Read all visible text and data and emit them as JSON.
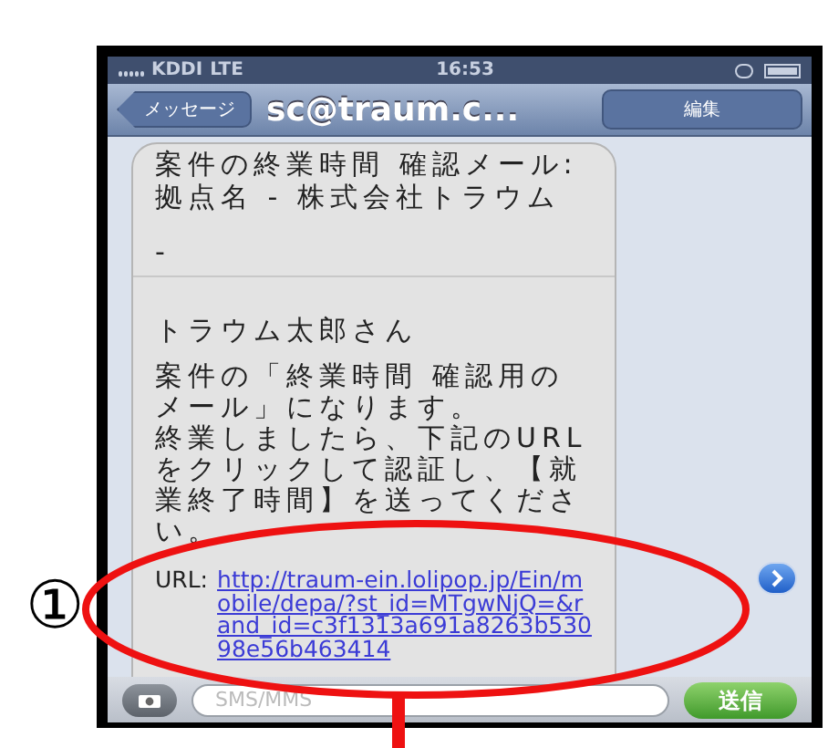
{
  "status_bar": {
    "carrier": "KDDI",
    "network": "LTE",
    "time": "16:53"
  },
  "nav_bar": {
    "back": "メッセージ",
    "title": "sc@traum.c...",
    "edit": "編集"
  },
  "message": {
    "subject": "案件の終業時間 確認メール:拠点名 - 株式会社トラウム",
    "separator": "-",
    "greeting": "トラウム太郎さん",
    "body": [
      "案件の「終業時間 確認用のメール」になります。",
      "終業しましたら、下記のURLをクリックして認証し、【就業終了時間】を送ってください。"
    ],
    "url_label": "URL:",
    "url": "http://traum-ein.lolipop.jp/Ein/mobile/depa/?st_id=MTgwNjQ=&rand_id=c3f1313a691a8263b53098e56b463414"
  },
  "input_bar": {
    "placeholder": "SMS/MMS",
    "send": "送信"
  },
  "annotation": {
    "marker": "①"
  }
}
